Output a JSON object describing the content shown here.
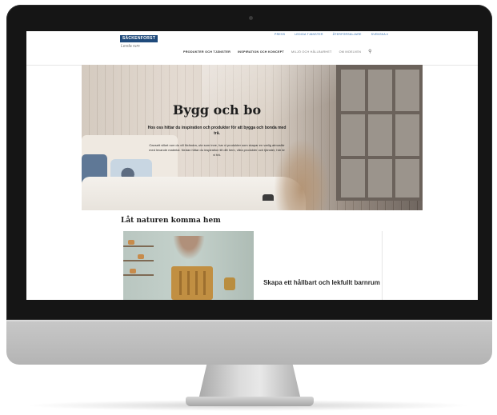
{
  "site": {
    "logo_text": "SÄCKENFORST",
    "tagline": "Levda rum"
  },
  "util_nav": [
    "PRESS",
    "LEDIGA TJÄNSTER",
    "ÅTERFÖRSÄLJARE",
    "SVENSKA ▾"
  ],
  "main_nav": [
    {
      "label": "PRODUKTER OCH TJÄNSTER"
    },
    {
      "label": "INSPIRATION OCH KONCEPT"
    },
    {
      "label": "MILJÖ OCH HÅLLBARHET"
    },
    {
      "label": "OM MOELVEN"
    }
  ],
  "search_icon": "search-icon",
  "hero": {
    "title": "Bygg och bo",
    "subtitle": "Hos oss hittar du inspiration och produkter för att bygga och bonda med trä.",
    "body": "Oavsett vilket rum du vill förändra, ute som inne, har vi produkter som skapar en varlig atmosfär med levande material. Nedan hittar du inspiration till ditt hem, våra produkter och tjänster, här är vi trä."
  },
  "section": {
    "title": "Låt naturen komma hem"
  },
  "card": {
    "title": "Skapa ett hållbart och lekfullt barnrum"
  },
  "colors": {
    "brand": "#1f4a7b",
    "link": "#2f6db0"
  }
}
